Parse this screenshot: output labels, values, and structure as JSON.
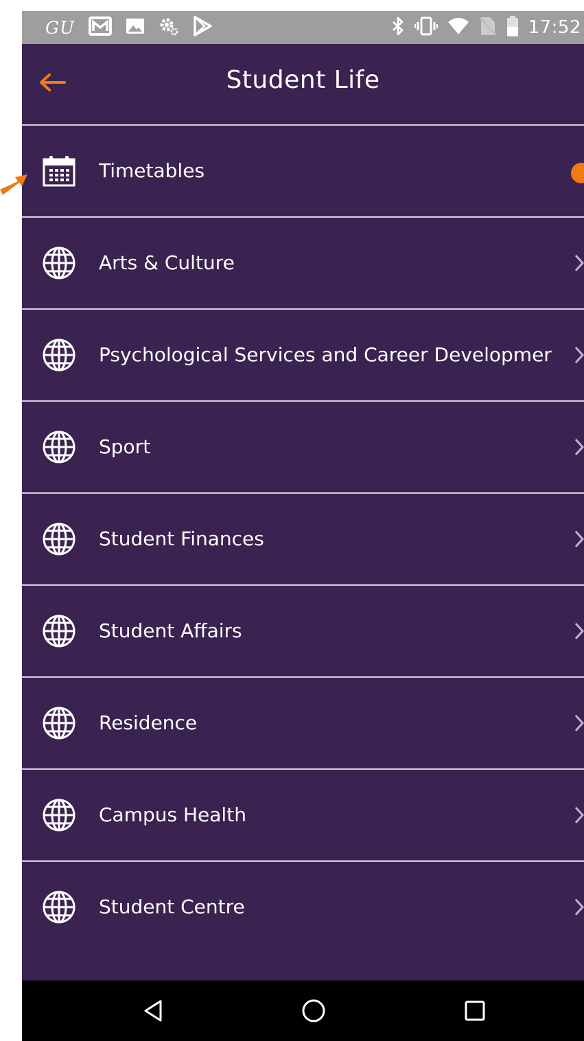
{
  "status_bar": {
    "carrier_text": "GU",
    "time": "17:52",
    "left_icons": [
      "mail-icon",
      "image-icon",
      "settings-icon",
      "play-store-icon"
    ],
    "right_icons": [
      "bluetooth-icon",
      "vibrate-icon",
      "wifi-icon",
      "no-sim-icon",
      "battery-icon"
    ]
  },
  "app_bar": {
    "title": "Student Life",
    "back_icon": "back-arrow-icon",
    "accent_color": "#f07b14"
  },
  "menu": {
    "items": [
      {
        "label": "Timetables",
        "icon": "calendar-icon"
      },
      {
        "label": "Arts & Culture",
        "icon": "globe-icon"
      },
      {
        "label": "Psychological Services and Career Developmer",
        "icon": "globe-icon"
      },
      {
        "label": "Sport",
        "icon": "globe-icon"
      },
      {
        "label": "Student Finances",
        "icon": "globe-icon"
      },
      {
        "label": "Student Affairs",
        "icon": "globe-icon"
      },
      {
        "label": "Residence",
        "icon": "globe-icon"
      },
      {
        "label": "Campus Health",
        "icon": "globe-icon"
      },
      {
        "label": "Student Centre",
        "icon": "globe-icon"
      }
    ]
  },
  "nav_bar": {
    "buttons": [
      "back-triangle-icon",
      "home-circle-icon",
      "recents-square-icon"
    ]
  },
  "colors": {
    "background": "#3a2350",
    "divider": "#d8d0e2",
    "status_bar": "#9e9e9e",
    "accent": "#f07b14"
  }
}
